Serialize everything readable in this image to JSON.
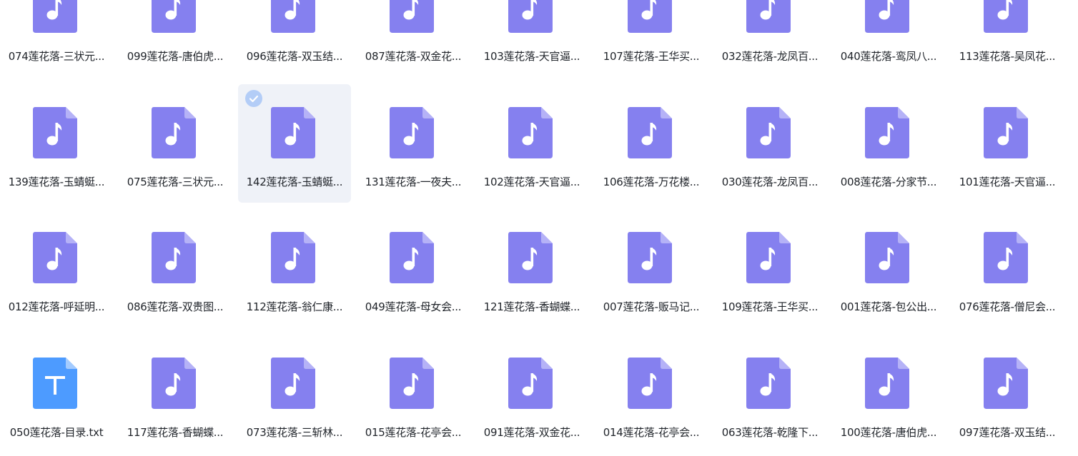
{
  "colors": {
    "audio_icon": "#8580ef",
    "audio_icon_fold": "#b5b2f7",
    "text_icon": "#4d9bff",
    "text_icon_fold": "#a3cbff",
    "selected_bg": "#eff2f8",
    "check_badge": "#b3cdf7"
  },
  "files": [
    {
      "name": "074莲花落-三状元...",
      "icon": "music-file-icon"
    },
    {
      "name": "099莲花落-唐伯虎...",
      "icon": "music-file-icon"
    },
    {
      "name": "096莲花落-双玉结...",
      "icon": "music-file-icon"
    },
    {
      "name": "087莲花落-双金花...",
      "icon": "music-file-icon"
    },
    {
      "name": "103莲花落-天官逼...",
      "icon": "music-file-icon"
    },
    {
      "name": "107莲花落-王华买...",
      "icon": "music-file-icon"
    },
    {
      "name": "032莲花落-龙凤百...",
      "icon": "music-file-icon"
    },
    {
      "name": "040莲花落-鸾凤八...",
      "icon": "music-file-icon"
    },
    {
      "name": "113莲花落-吴凤花...",
      "icon": "music-file-icon"
    },
    {
      "name": "139莲花落-玉蜻蜓...",
      "icon": "music-file-icon"
    },
    {
      "name": "075莲花落-三状元...",
      "icon": "music-file-icon"
    },
    {
      "name": "142莲花落-玉蜻蜓...",
      "icon": "music-file-icon",
      "selected": true
    },
    {
      "name": "131莲花落-一夜夫...",
      "icon": "music-file-icon"
    },
    {
      "name": "102莲花落-天官逼...",
      "icon": "music-file-icon"
    },
    {
      "name": "106莲花落-万花楼...",
      "icon": "music-file-icon"
    },
    {
      "name": "030莲花落-龙凤百...",
      "icon": "music-file-icon"
    },
    {
      "name": "008莲花落-分家节...",
      "icon": "music-file-icon"
    },
    {
      "name": "101莲花落-天官逼...",
      "icon": "music-file-icon"
    },
    {
      "name": "012莲花落-呼延明...",
      "icon": "music-file-icon"
    },
    {
      "name": "086莲花落-双贵图...",
      "icon": "music-file-icon"
    },
    {
      "name": "112莲花落-翁仁康...",
      "icon": "music-file-icon"
    },
    {
      "name": "049莲花落-母女会...",
      "icon": "music-file-icon"
    },
    {
      "name": "121莲花落-香蝴蝶...",
      "icon": "music-file-icon"
    },
    {
      "name": "007莲花落-贩马记...",
      "icon": "music-file-icon"
    },
    {
      "name": "109莲花落-王华买...",
      "icon": "music-file-icon"
    },
    {
      "name": "001莲花落-包公出...",
      "icon": "music-file-icon"
    },
    {
      "name": "076莲花落-僧尼会...",
      "icon": "music-file-icon"
    },
    {
      "name": "050莲花落-目录.txt",
      "icon": "text-file-icon"
    },
    {
      "name": "117莲花落-香蝴蝶...",
      "icon": "music-file-icon"
    },
    {
      "name": "073莲花落-三斩林...",
      "icon": "music-file-icon"
    },
    {
      "name": "015莲花落-花亭会...",
      "icon": "music-file-icon"
    },
    {
      "name": "091莲花落-双金花...",
      "icon": "music-file-icon"
    },
    {
      "name": "014莲花落-花亭会...",
      "icon": "music-file-icon"
    },
    {
      "name": "063莲花落-乾隆下...",
      "icon": "music-file-icon"
    },
    {
      "name": "100莲花落-唐伯虎...",
      "icon": "music-file-icon"
    },
    {
      "name": "097莲花落-双玉结...",
      "icon": "music-file-icon"
    }
  ]
}
